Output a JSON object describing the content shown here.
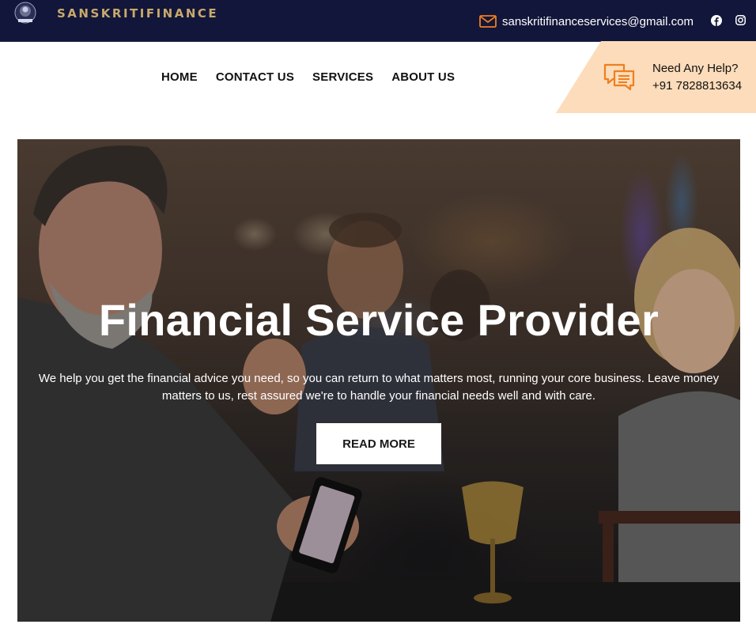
{
  "topbar": {
    "brand": "SANSKRITIFINANCE",
    "email": "sanskritifinanceservices@gmail.com",
    "icons": [
      "logo-emblem",
      "mail-icon",
      "facebook-icon",
      "instagram-icon"
    ]
  },
  "nav": {
    "items": [
      {
        "label": "HOME"
      },
      {
        "label": "CONTACT US"
      },
      {
        "label": "SERVICES"
      },
      {
        "label": "ABOUT US"
      }
    ]
  },
  "help": {
    "title": "Need Any Help?",
    "phone": "+91 7828813634",
    "icon": "chat-icon"
  },
  "hero": {
    "title": "Financial Service Provider",
    "text": "We help you get the financial advice you need, so you can return to what matters most, running your core business. Leave money matters to us, rest assured we're to handle your financial needs well and with care.",
    "button": "READ MORE"
  },
  "colors": {
    "topbar_bg": "#12163a",
    "brand_gold": "#c9a96a",
    "help_panel": "#fcdcba",
    "accent_orange": "#f07e1f"
  }
}
